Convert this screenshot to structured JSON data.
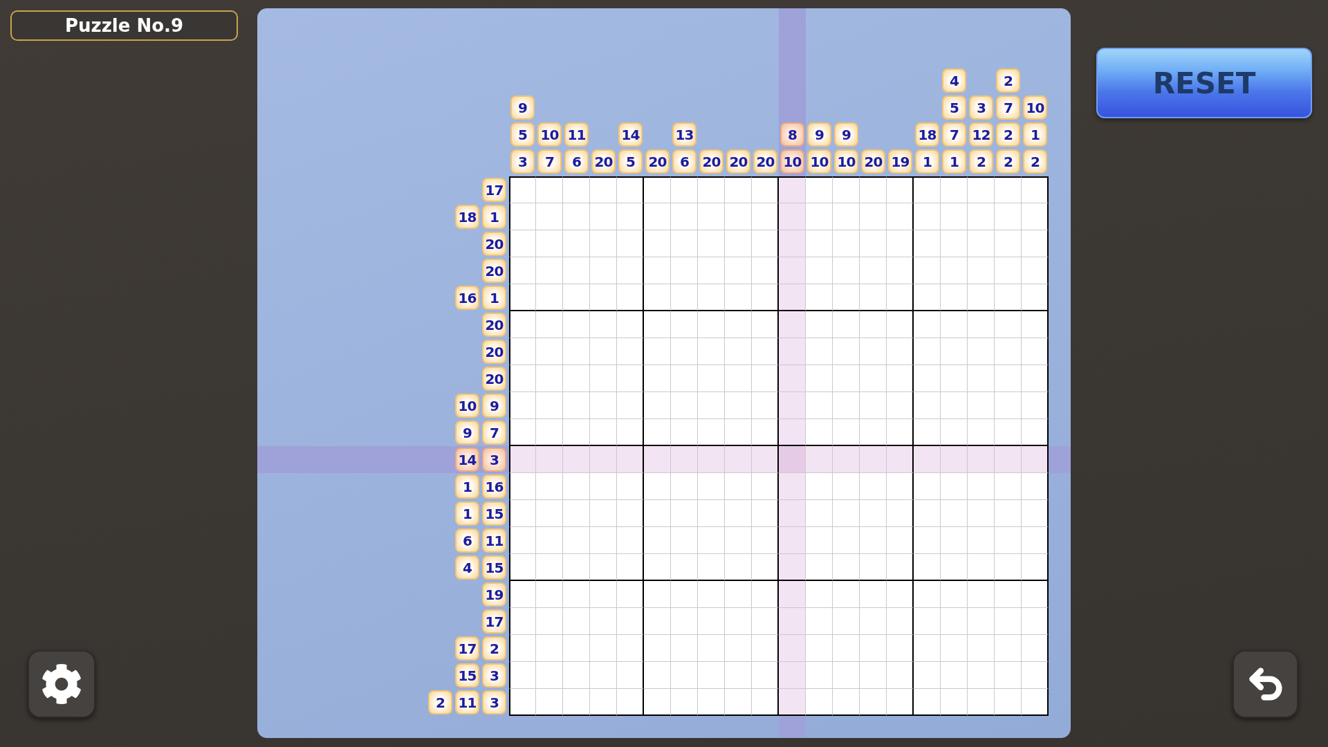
{
  "title": "Puzzle No.9",
  "reset_button": {
    "label": "RESET"
  },
  "puzzle": {
    "column_clues": [
      {
        "numbers": [
          "9",
          "5",
          "3"
        ],
        "highlighted": false
      },
      {
        "numbers": [
          "10",
          "7"
        ],
        "highlighted": false
      },
      {
        "numbers": [
          "11",
          "6"
        ],
        "highlighted": false
      },
      {
        "numbers": [
          "20"
        ],
        "highlighted": false
      },
      {
        "numbers": [
          "14",
          "5"
        ],
        "highlighted": false
      },
      {
        "numbers": [
          "20"
        ],
        "highlighted": false
      },
      {
        "numbers": [
          "13",
          "6"
        ],
        "highlighted": false
      },
      {
        "numbers": [
          "20"
        ],
        "highlighted": false
      },
      {
        "numbers": [
          "20"
        ],
        "highlighted": false
      },
      {
        "numbers": [
          "20"
        ],
        "highlighted": false
      },
      {
        "numbers": [
          "8",
          "10"
        ],
        "highlighted": true
      },
      {
        "numbers": [
          "9",
          "10"
        ],
        "highlighted": false
      },
      {
        "numbers": [
          "9",
          "10"
        ],
        "highlighted": false
      },
      {
        "numbers": [
          "20"
        ],
        "highlighted": false
      },
      {
        "numbers": [
          "19"
        ],
        "highlighted": false
      },
      {
        "numbers": [
          "18",
          "1"
        ],
        "highlighted": false
      },
      {
        "numbers": [
          "4",
          "5",
          "7",
          "1"
        ],
        "highlighted": false
      },
      {
        "numbers": [
          "3",
          "12",
          "2"
        ],
        "highlighted": false
      },
      {
        "numbers": [
          "2",
          "7",
          "2",
          "2"
        ],
        "highlighted": false
      },
      {
        "numbers": [
          "10",
          "1",
          "2"
        ],
        "highlighted": false
      }
    ],
    "row_clues": [
      {
        "numbers": [
          "17"
        ],
        "highlighted": false
      },
      {
        "numbers": [
          "18",
          "1"
        ],
        "highlighted": false
      },
      {
        "numbers": [
          "20"
        ],
        "highlighted": false
      },
      {
        "numbers": [
          "20"
        ],
        "highlighted": false
      },
      {
        "numbers": [
          "16",
          "1"
        ],
        "highlighted": false
      },
      {
        "numbers": [
          "20"
        ],
        "highlighted": false
      },
      {
        "numbers": [
          "20"
        ],
        "highlighted": false
      },
      {
        "numbers": [
          "20"
        ],
        "highlighted": false
      },
      {
        "numbers": [
          "10",
          "9"
        ],
        "highlighted": false
      },
      {
        "numbers": [
          "9",
          "7"
        ],
        "highlighted": false
      },
      {
        "numbers": [
          "14",
          "3"
        ],
        "highlighted": true
      },
      {
        "numbers": [
          "1",
          "16"
        ],
        "highlighted": false
      },
      {
        "numbers": [
          "1",
          "15"
        ],
        "highlighted": false
      },
      {
        "numbers": [
          "6",
          "11"
        ],
        "highlighted": false
      },
      {
        "numbers": [
          "4",
          "15"
        ],
        "highlighted": false
      },
      {
        "numbers": [
          "19"
        ],
        "highlighted": false
      },
      {
        "numbers": [
          "17"
        ],
        "highlighted": false
      },
      {
        "numbers": [
          "17",
          "2"
        ],
        "highlighted": false
      },
      {
        "numbers": [
          "15",
          "3"
        ],
        "highlighted": false
      },
      {
        "numbers": [
          "2",
          "11",
          "3"
        ],
        "highlighted": false
      }
    ]
  }
}
